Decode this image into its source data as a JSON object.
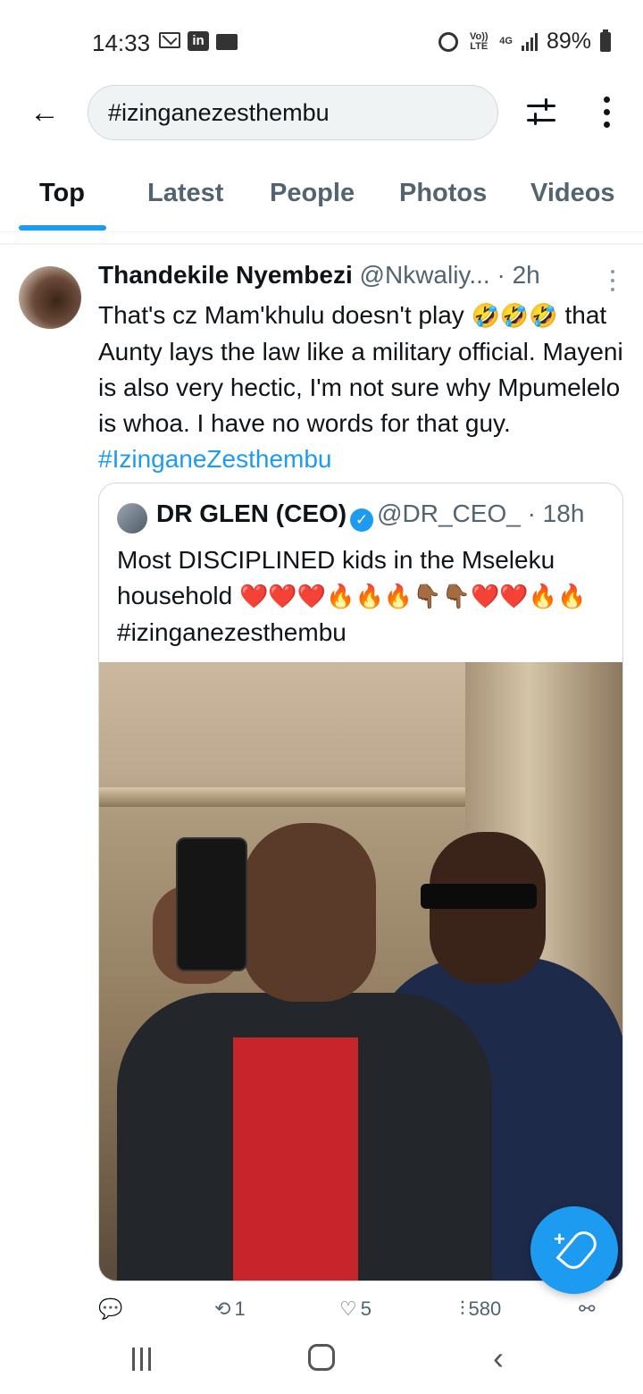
{
  "status_bar": {
    "time": "14:33",
    "battery": "89%",
    "network": "4G",
    "volte": "Vo)) LTE",
    "icons": [
      "mail-icon",
      "linkedin-icon",
      "folder-icon",
      "alarm-icon",
      "signal-icon",
      "battery-icon"
    ]
  },
  "search": {
    "query": "#izinganezesthembu"
  },
  "tabs": [
    {
      "label": "Top",
      "active": true
    },
    {
      "label": "Latest",
      "active": false
    },
    {
      "label": "People",
      "active": false
    },
    {
      "label": "Photos",
      "active": false
    },
    {
      "label": "Videos",
      "active": false
    }
  ],
  "tweet": {
    "author_name": "Thandekile Nyembezi",
    "author_handle": "@Nkwaliy...",
    "time": "· 2h",
    "text_part1": "That's cz Mam'khulu doesn't play ",
    "text_emojis1": "🤣🤣🤣",
    "text_part2": " that Aunty lays the law like a military official. Mayeni is also very hectic, I'm not sure why Mpumelelo is whoa. I have no words for that guy. ",
    "hashtag": "#IzinganeZesthembu",
    "quote": {
      "author_name": "DR GLEN (CEO)",
      "author_handle": "@DR_CEO_",
      "time": "· 18h",
      "text_part1": "Most DISCIPLINED kids in the  Mseleku household ",
      "text_emojis": "❤️❤️❤️🔥🔥🔥👇🏾👇🏾❤️❤️🔥🔥",
      "hashtag": "#izinganezesthembu"
    },
    "actions": {
      "reply_count": "",
      "retweet_count": "1",
      "like_count": "5",
      "views_count": "580"
    }
  },
  "colors": {
    "accent": "#1d9bf0",
    "text_primary": "#0f1419",
    "text_secondary": "#536471"
  }
}
